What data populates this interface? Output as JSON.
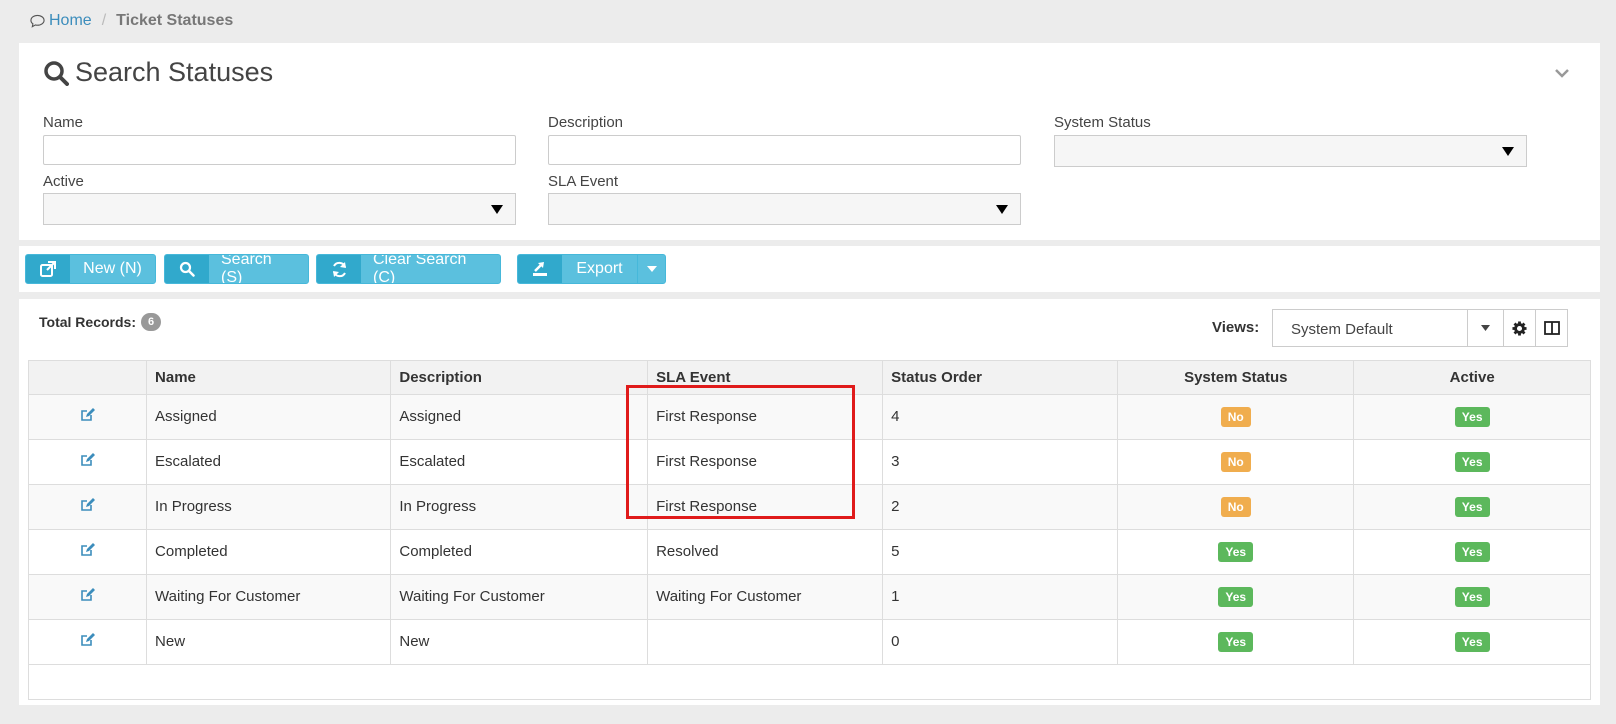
{
  "breadcrumb": {
    "home": "Home",
    "current": "Ticket Statuses"
  },
  "search": {
    "title": "Search Statuses",
    "fields": {
      "name": {
        "label": "Name",
        "value": ""
      },
      "description": {
        "label": "Description",
        "value": ""
      },
      "system_status": {
        "label": "System Status",
        "value": ""
      },
      "active": {
        "label": "Active",
        "value": ""
      },
      "sla_event": {
        "label": "SLA Event",
        "value": ""
      }
    }
  },
  "toolbar": {
    "new_label": "New (N)",
    "search_label": "Search (S)",
    "clear_label": "Clear Search (C)",
    "export_label": "Export"
  },
  "grid": {
    "total_label": "Total Records:",
    "total_count": "6",
    "views_label": "Views:",
    "views_value": "System Default",
    "columns": [
      "",
      "Name",
      "Description",
      "SLA Event",
      "Status Order",
      "System Status",
      "Active"
    ],
    "rows": [
      {
        "name": "Assigned",
        "description": "Assigned",
        "sla_event": "First Response",
        "order": "4",
        "system_status": "No",
        "active": "Yes"
      },
      {
        "name": "Escalated",
        "description": "Escalated",
        "sla_event": "First Response",
        "order": "3",
        "system_status": "No",
        "active": "Yes"
      },
      {
        "name": "In Progress",
        "description": "In Progress",
        "sla_event": "First Response",
        "order": "2",
        "system_status": "No",
        "active": "Yes"
      },
      {
        "name": "Completed",
        "description": "Completed",
        "sla_event": "Resolved",
        "order": "5",
        "system_status": "Yes",
        "active": "Yes"
      },
      {
        "name": "Waiting For Customer",
        "description": "Waiting For Customer",
        "sla_event": "Waiting For Customer",
        "order": "1",
        "system_status": "Yes",
        "active": "Yes"
      },
      {
        "name": "New",
        "description": "New",
        "sla_event": "",
        "order": "0",
        "system_status": "Yes",
        "active": "Yes"
      }
    ]
  },
  "colors": {
    "accent": "#5bc0de",
    "yes": "#5cb85c",
    "no": "#f0ad4e",
    "highlight": "#e01b1b",
    "link": "#3c8dbc"
  }
}
